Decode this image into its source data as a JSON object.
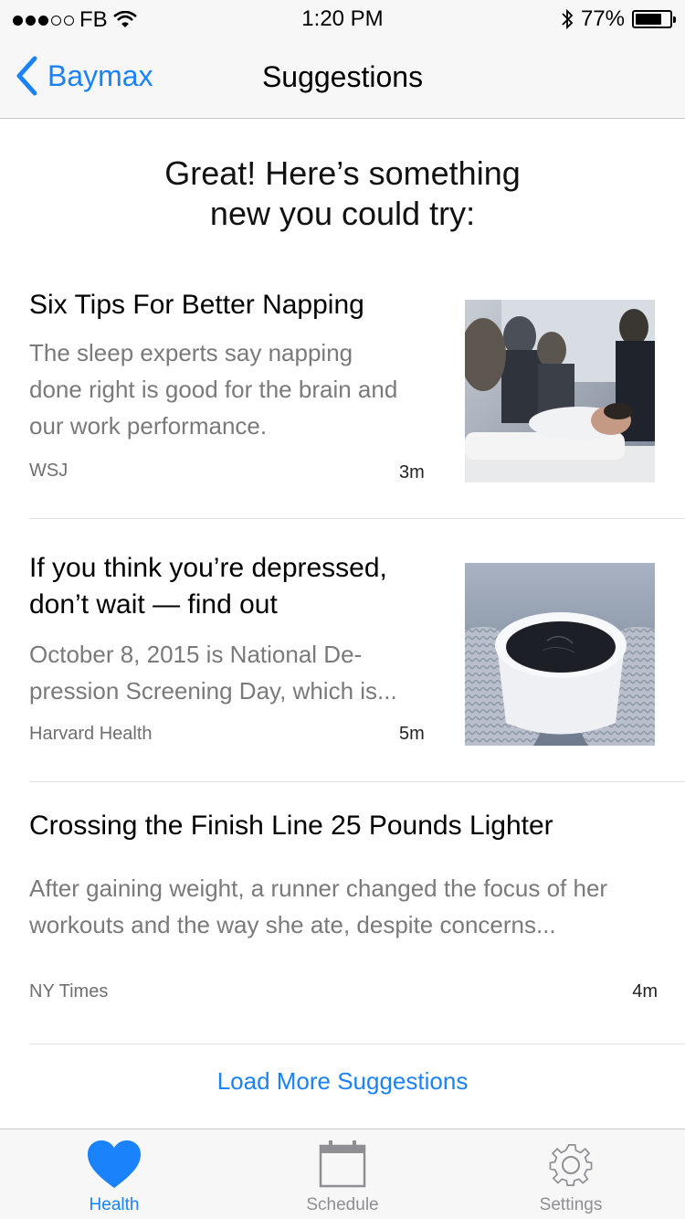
{
  "status_bar": {
    "carrier": "FB",
    "time": "1:20 PM",
    "battery": "77%",
    "battery_level": 0.77
  },
  "nav": {
    "back_label": "Baymax",
    "title": "Suggestions"
  },
  "headline": {
    "line1": "Great! Here’s something",
    "line2": "new you could try:"
  },
  "articles": [
    {
      "title": "Six Tips For Better Napping",
      "desc_lines": [
        "The sleep experts say napping",
        "done right is good for the brain and",
        "our work performance."
      ],
      "source": "WSJ",
      "time": "3m",
      "thumb_icon": "napping-photo"
    },
    {
      "title_lines": [
        "If you think you’re depressed,",
        "don’t wait — find out"
      ],
      "desc_lines": [
        "October 8, 2015 is National De-",
        "pression Screening Day, which is..."
      ],
      "source": "Harvard Health",
      "time": "5m",
      "thumb_icon": "coffee-cup-photo"
    },
    {
      "title": "Crossing the Finish Line 25 Pounds Lighter",
      "desc_lines": [
        "After gaining weight, a runner changed the focus of her",
        "workouts and the way she ate, despite concerns..."
      ],
      "source": "NY Times",
      "time": "4m"
    }
  ],
  "load_more_label": "Load More Suggestions",
  "tabs": [
    {
      "label": "Health",
      "icon": "heart-icon",
      "active": true
    },
    {
      "label": "Schedule",
      "icon": "calendar-icon",
      "active": false
    },
    {
      "label": "Settings",
      "icon": "gear-icon",
      "active": false
    }
  ],
  "colors": {
    "accent": "#1a82fb",
    "inactive": "#8e8e93",
    "secondary_text": "#7a7a7a"
  }
}
